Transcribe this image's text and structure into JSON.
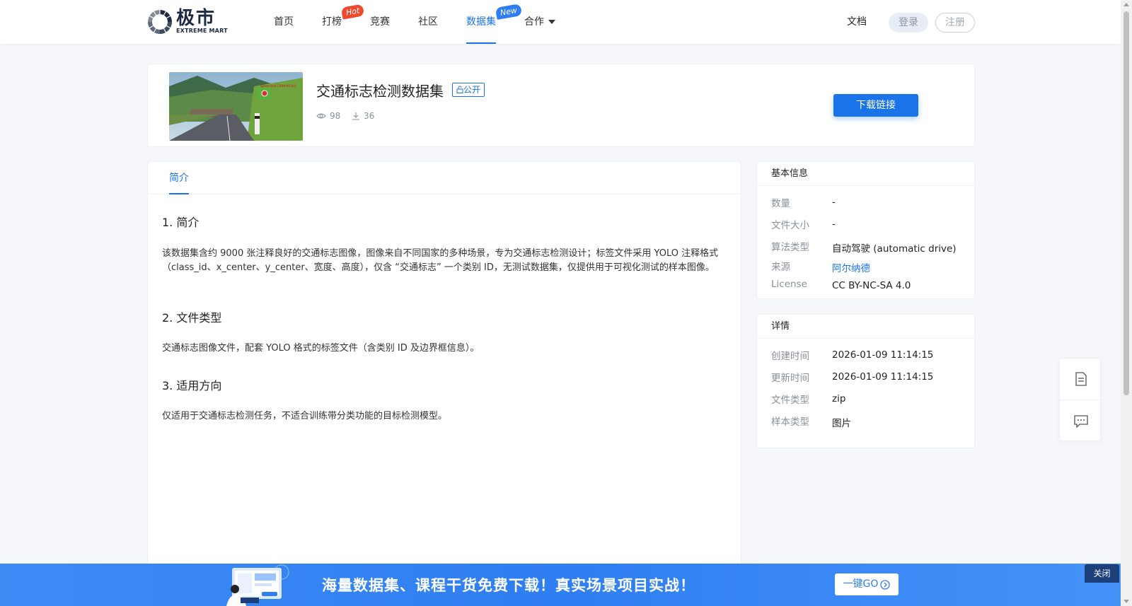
{
  "brand": {
    "name": "极市",
    "sub": "EXTREME MART"
  },
  "nav": {
    "items": [
      {
        "label": "首页"
      },
      {
        "label": "打榜",
        "badge": "Hot"
      },
      {
        "label": "竞赛"
      },
      {
        "label": "社区"
      },
      {
        "label": "数据集",
        "badge": "New",
        "active": true
      },
      {
        "label": "合作"
      }
    ],
    "docs": "文档",
    "login": "登录",
    "register": "注册"
  },
  "dataset": {
    "title": "交通标志检测数据集",
    "visibility": "公开",
    "views": "98",
    "downloads": "36",
    "download_button": "下载链接"
  },
  "tabs": [
    {
      "label": "简介"
    }
  ],
  "intro": {
    "sections": [
      {
        "heading": "1. 简介",
        "text": "该数据集含约 9000 张注释良好的交通标志图像，图像来自不同国家的多种场景，专为交通标志检测设计；标签文件采用 YOLO 注释格式（class_id、x_center、y_center、宽度、高度），仅含 “交通标志” 一个类别 ID，无测试数据集，仅提供用于可视化测试的样本图像。"
      },
      {
        "heading": "2. 文件类型",
        "text": "交通标志图像文件，配套 YOLO 格式的标签文件（含类别 ID 及边界框信息）。"
      },
      {
        "heading": "3. 适用方向",
        "text": "仅适用于交通标志检测任务，不适合训练带分类功能的目标检测模型。"
      }
    ]
  },
  "basic_info": {
    "title": "基本信息",
    "rows": [
      {
        "key": "数量",
        "value": "-"
      },
      {
        "key": "文件大小",
        "value": "-"
      },
      {
        "key": "算法类型",
        "value": "自动驾驶 (automatic drive)"
      },
      {
        "key": "来源",
        "value": "阿尔纳德"
      },
      {
        "key": "License",
        "value": "CC BY-NC-SA 4.0"
      }
    ]
  },
  "details": {
    "title": "详情",
    "rows": [
      {
        "key": "创建时间",
        "value": "2026-01-09 11:14:15"
      },
      {
        "key": "更新时间",
        "value": "2026-01-09 11:14:15"
      },
      {
        "key": "文件类型",
        "value": "zip"
      },
      {
        "key": "样本类型",
        "value": "图片"
      }
    ]
  },
  "floating_tools": {
    "icons": [
      "document-icon",
      "chat-icon"
    ]
  },
  "banner": {
    "text": "海量数据集、课程干货免费下载！真实场景项目实战！",
    "button": "一键GO",
    "close": "关闭"
  },
  "colors": {
    "accent": "#1a73e8",
    "hot": "#f04a2e",
    "new": "#2e7cf6",
    "banner": "#2f7ef2"
  }
}
